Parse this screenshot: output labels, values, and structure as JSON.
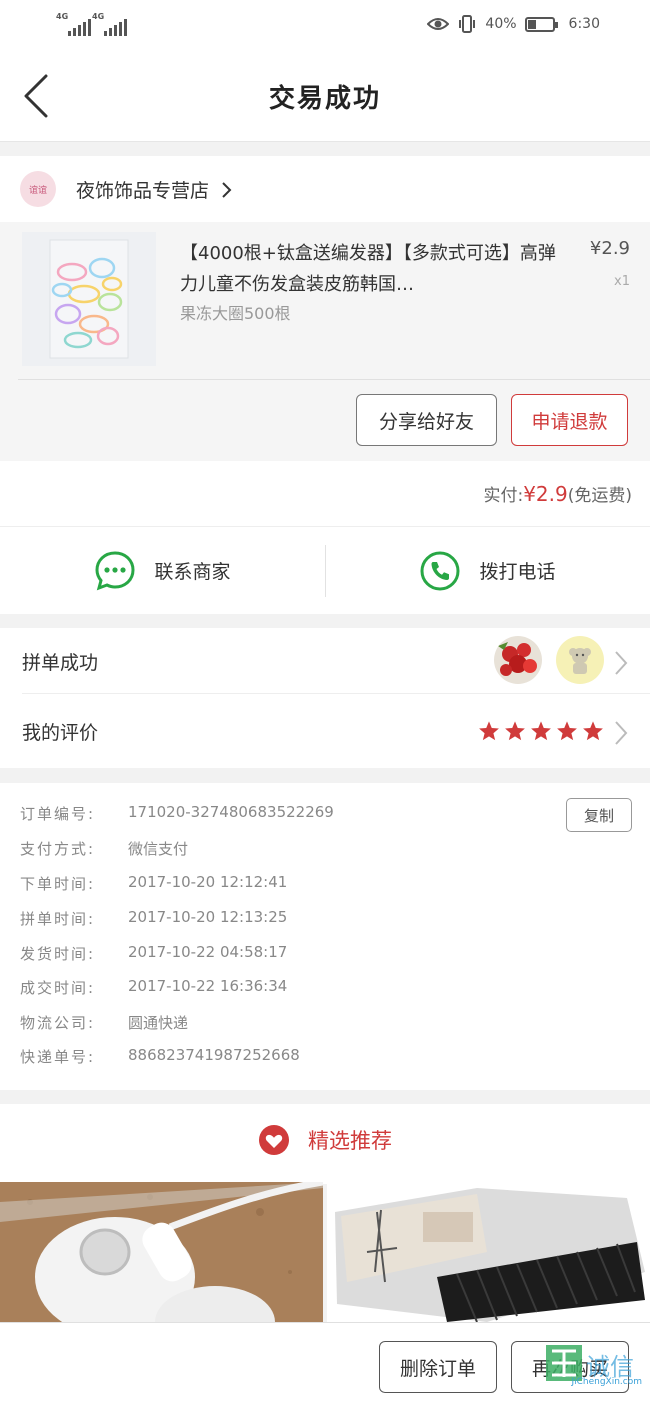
{
  "status_bar": {
    "signal_1": "4G",
    "signal_2": "4G",
    "battery_percent": "40%",
    "battery_level": 0.4,
    "time": "6:30",
    "icons": [
      "eye-icon",
      "vibrate-icon",
      "battery-icon"
    ]
  },
  "header": {
    "title": "交易成功",
    "back_icon": "back-arrow-icon"
  },
  "shop": {
    "logo_text": "谊谊",
    "name": "夜饰饰品专营店",
    "chevron_icon": "chevron-right-icon"
  },
  "product": {
    "title": "【4000根+钛盒送编发器】【多款式可选】高弹力儿童不伤发盒装皮筋韩国…",
    "spec": "果冻大圈500根",
    "price": "¥2.9",
    "quantity": "x1",
    "share_button": "分享给好友",
    "refund_button": "申请退款"
  },
  "total": {
    "label": "实付:",
    "amount": "¥2.9",
    "note": "(免运费)"
  },
  "contact": {
    "seller_label": "联系商家",
    "call_label": "拨打电话",
    "accent": "#28a745"
  },
  "rows": {
    "group_label": "拼单成功",
    "review_label": "我的评价",
    "stars": 5
  },
  "order_info": {
    "copy_button": "复制",
    "lines": [
      {
        "key": "订单编号:",
        "value": "171020-327480683522269"
      },
      {
        "key": "支付方式:",
        "value": "微信支付"
      },
      {
        "key": "下单时间:",
        "value": "2017-10-20 12:12:41"
      },
      {
        "key": "拼单时间:",
        "value": "2017-10-20 12:13:25"
      },
      {
        "key": "发货时间:",
        "value": "2017-10-22 04:58:17"
      },
      {
        "key": "成交时间:",
        "value": "2017-10-22 16:36:34"
      },
      {
        "key": "物流公司:",
        "value": "圆通快递"
      },
      {
        "key": "快递单号:",
        "value": "886823741987252668"
      }
    ]
  },
  "recommend": {
    "title": "精选推荐",
    "heart_icon": "heart-icon"
  },
  "footer": {
    "delete_button": "删除订单",
    "rebuy_button": "再次购买",
    "watermark": "集诚信",
    "watermark_url": "JiChengXin.com"
  },
  "colors": {
    "accent_red": "#d03b3b",
    "green": "#28a745"
  }
}
